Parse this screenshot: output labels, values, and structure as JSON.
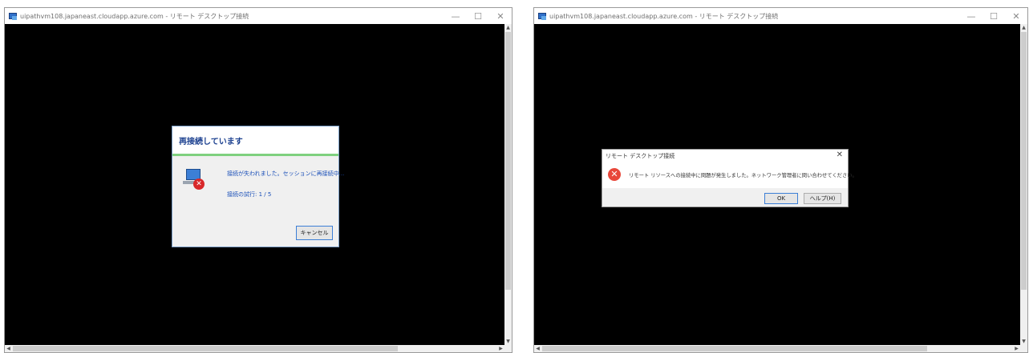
{
  "left_window": {
    "title": "uipathvm108.japaneast.cloudapp.azure.com - リモート デスクトップ接続",
    "controls": {
      "minimize": "—",
      "maximize": "☐",
      "close": "✕"
    },
    "dialog": {
      "title": "再接続しています",
      "message": "接続が失われました。セッションに再接続中...",
      "attempt": "接続の試行: 1 / 5",
      "cancel_label": "キャンセル"
    }
  },
  "right_window": {
    "title": "uipathvm108.japaneast.cloudapp.azure.com - リモート デスクトップ接続",
    "controls": {
      "minimize": "—",
      "maximize": "☐",
      "close": "✕"
    },
    "dialog": {
      "title": "リモート デスクトップ接続",
      "close": "✕",
      "message": "リモート リソースへの接続中に問題が発生しました。ネットワーク管理者に問い合わせてください。",
      "ok_label": "OK",
      "help_label": "ヘルプ(H)"
    }
  },
  "icons": {
    "app": "remote-desktop-icon",
    "reconnect": "disconnected-computer-icon",
    "error": "error-icon"
  }
}
